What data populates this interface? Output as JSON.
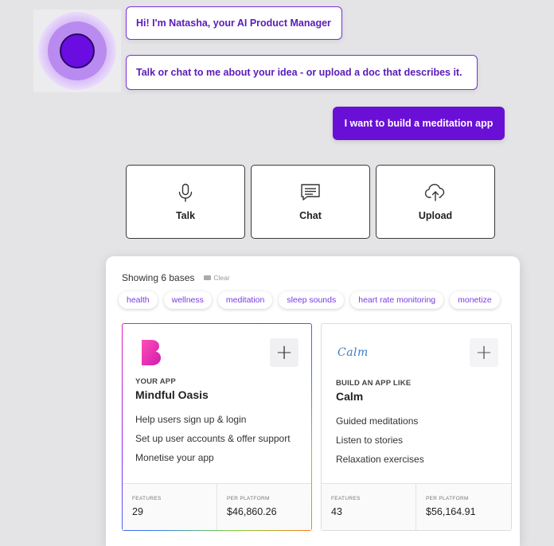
{
  "chat": {
    "bot_message_1": "Hi! I'm Natasha, your AI Product Manager",
    "bot_message_2": "Talk or chat to me about your idea - or upload a doc that describes it.",
    "user_message": "I want to build a meditation app"
  },
  "actions": [
    {
      "label": "Talk",
      "icon": "microphone-icon"
    },
    {
      "label": "Chat",
      "icon": "chat-icon"
    },
    {
      "label": "Upload",
      "icon": "cloud-upload-icon"
    }
  ],
  "bases": {
    "showing_text": "Showing 6 bases",
    "clear_label": "Clear",
    "chips": [
      "health",
      "wellness",
      "meditation",
      "sleep sounds",
      "heart rate monitoring",
      "monetize"
    ]
  },
  "cards": [
    {
      "kicker": "YOUR APP",
      "title": "Mindful Oasis",
      "features": [
        "Help users sign up & login",
        "Set up user accounts & offer support",
        "Monetise your app"
      ],
      "features_label": "FEATURES",
      "features_count": "29",
      "price_label": "PER PLATFORM",
      "price": "$46,860.26"
    },
    {
      "logo_text": "Calm",
      "kicker": "BUILD AN APP LIKE",
      "title": "Calm",
      "features": [
        "Guided meditations",
        "Listen to stories",
        "Relaxation exercises"
      ],
      "features_label": "FEATURES",
      "features_count": "43",
      "price_label": "PER PLATFORM",
      "price": "$56,164.91"
    }
  ],
  "colors": {
    "accent": "#6a0fd6",
    "bubble_text": "#5a1bb8",
    "chip_text": "#7a3be0",
    "background": "#e4e4e6"
  }
}
